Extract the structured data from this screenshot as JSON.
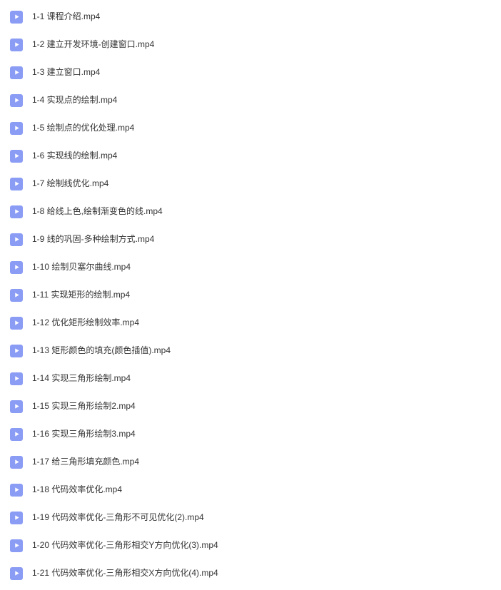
{
  "files": [
    {
      "name": "1-1 课程介绍.mp4"
    },
    {
      "name": "1-2 建立开发环境-创建窗口.mp4"
    },
    {
      "name": "1-3 建立窗口.mp4"
    },
    {
      "name": "1-4 实现点的绘制.mp4"
    },
    {
      "name": "1-5 绘制点的优化处理.mp4"
    },
    {
      "name": "1-6 实现线的绘制.mp4"
    },
    {
      "name": "1-7 绘制线优化.mp4"
    },
    {
      "name": "1-8 给线上色,绘制渐变色的线.mp4"
    },
    {
      "name": "1-9 线的巩固-多种绘制方式.mp4"
    },
    {
      "name": "1-10 绘制贝塞尔曲线.mp4"
    },
    {
      "name": "1-11 实现矩形的绘制.mp4"
    },
    {
      "name": "1-12 优化矩形绘制效率.mp4"
    },
    {
      "name": "1-13 矩形颜色的填充(颜色插值).mp4"
    },
    {
      "name": "1-14 实现三角形绘制.mp4"
    },
    {
      "name": "1-15 实现三角形绘制2.mp4"
    },
    {
      "name": "1-16 实现三角形绘制3.mp4"
    },
    {
      "name": "1-17 给三角形填充颜色.mp4"
    },
    {
      "name": "1-18 代码效率优化.mp4"
    },
    {
      "name": "1-19 代码效率优化-三角形不可见优化(2).mp4"
    },
    {
      "name": "1-20 代码效率优化-三角形相交Y方向优化(3).mp4"
    },
    {
      "name": "1-21 代码效率优化-三角形相交X方向优化(4).mp4"
    }
  ]
}
